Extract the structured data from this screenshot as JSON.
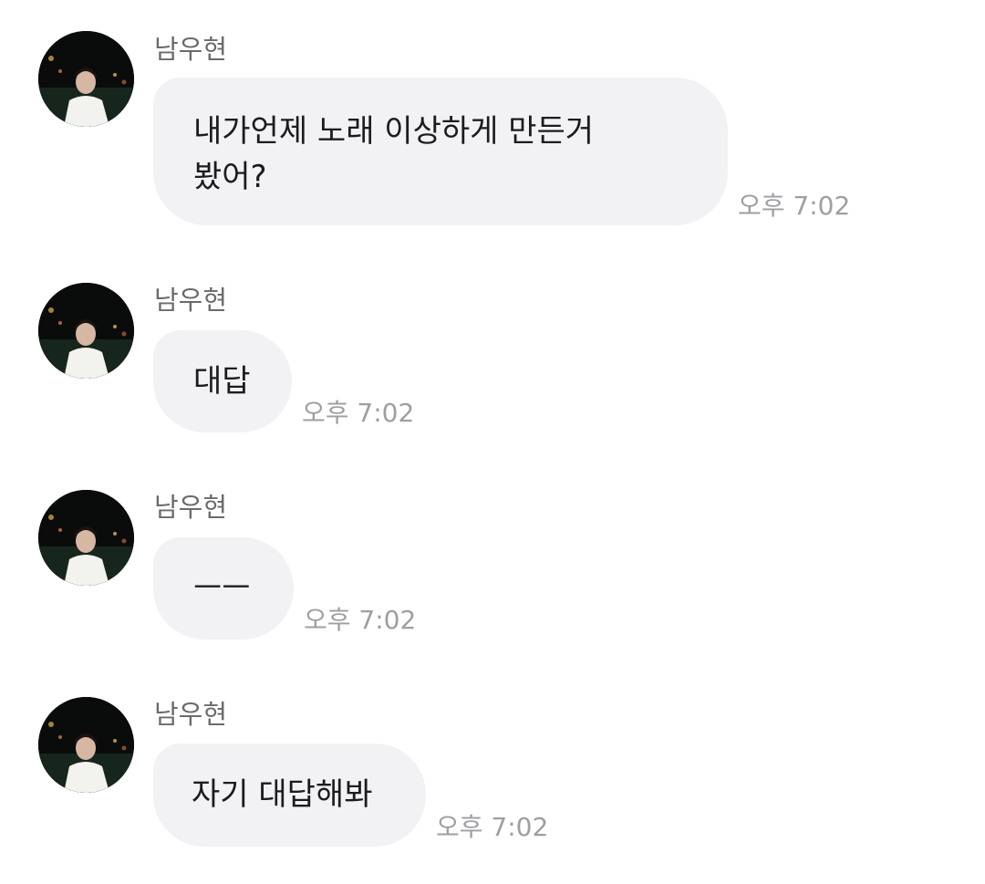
{
  "messages": [
    {
      "sender": "남우현",
      "lines": [
        "내가언제 노래 이상하게 만든거",
        "봤어?"
      ],
      "time": "오후 7:02"
    },
    {
      "sender": "남우현",
      "lines": [
        "대답"
      ],
      "time": "오후 7:02"
    },
    {
      "sender": "남우현",
      "lines": [
        "ㅡㅡ"
      ],
      "time": "오후 7:02"
    },
    {
      "sender": "남우현",
      "lines": [
        "자기 대답해봐"
      ],
      "time": "오후 7:02"
    }
  ],
  "colors": {
    "bubble": "#f2f2f4",
    "sender": "#6b6b6b",
    "time": "#9e9ea3",
    "text": "#1c1c1e"
  },
  "icons": {
    "avatar": "profile-photo-avatar"
  }
}
